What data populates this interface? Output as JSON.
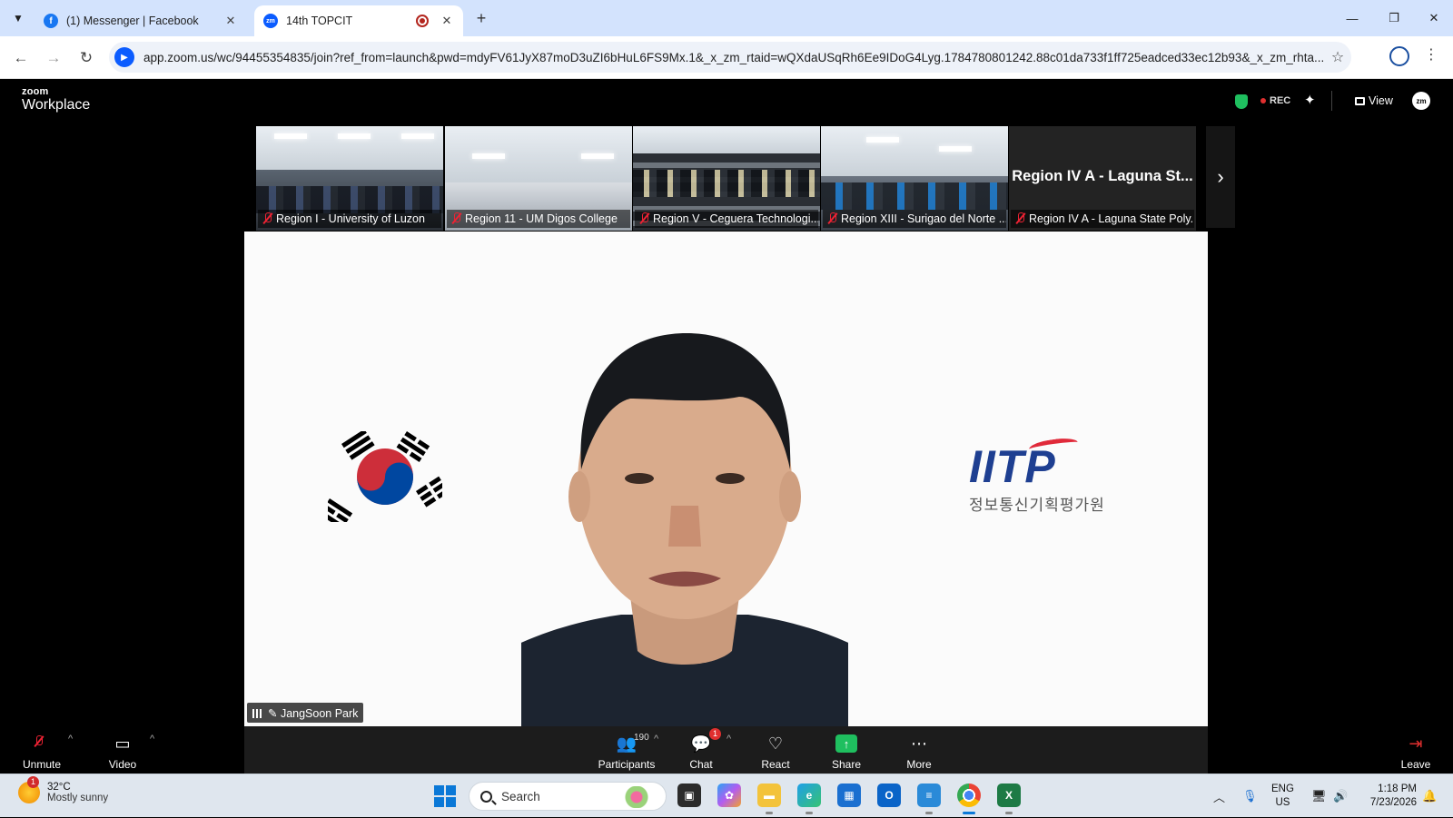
{
  "browser": {
    "tabs": [
      {
        "title": "(1) Messenger | Facebook",
        "favicon": "facebook-icon",
        "active": false
      },
      {
        "title": "14th TOPCIT",
        "favicon": "zoom-icon",
        "active": true,
        "recording": true
      }
    ],
    "url": "app.zoom.us/wc/94455354835/join?ref_from=launch&pwd=mdyFV61JyX87moD3uZI6bHuL6FS9Mx.1&_x_zm_rtaid=wQXdaUSqRh6Ee9IDoG4Lyg.1784780801242.88c01da733f1ff725eadced33ec12b93&_x_zm_rhta..."
  },
  "zoom": {
    "logo_small": "zoom",
    "logo_big": "Workplace",
    "rec_label": "REC",
    "view_label": "View",
    "avatar_text": "zm",
    "thumbnails": [
      {
        "label": "Region I - University of Luzon"
      },
      {
        "label": "Region 11 - UM Digos College"
      },
      {
        "label": "Region V - Ceguera Technologi..."
      },
      {
        "label": "Region XIII - Surigao del Norte ..."
      },
      {
        "label": "Region IV A - Laguna State Poly...",
        "display_name": "Region IV A - Laguna St..."
      }
    ],
    "speaker": {
      "name": "JangSoon Park",
      "logo_mark": "IITP",
      "logo_sub": "정보통신기획평가원"
    },
    "controls": {
      "unmute": "Unmute",
      "video": "Video",
      "participants": "Participants",
      "participants_count": "190",
      "chat": "Chat",
      "chat_badge": "1",
      "react": "React",
      "share": "Share",
      "more": "More",
      "leave": "Leave"
    }
  },
  "taskbar": {
    "weather_temp": "32°C",
    "weather_desc": "Mostly sunny",
    "weather_badge": "1",
    "search_placeholder": "Search",
    "lang_1": "ENG",
    "lang_2": "US",
    "time": "1:18 PM",
    "date": "7/23/2026"
  },
  "colors": {
    "zoom_blue": "#0b5cff",
    "share_green": "#1fbf5f",
    "rec_red": "#e02f2f",
    "browser_tab_bg": "#d3e3fd"
  }
}
